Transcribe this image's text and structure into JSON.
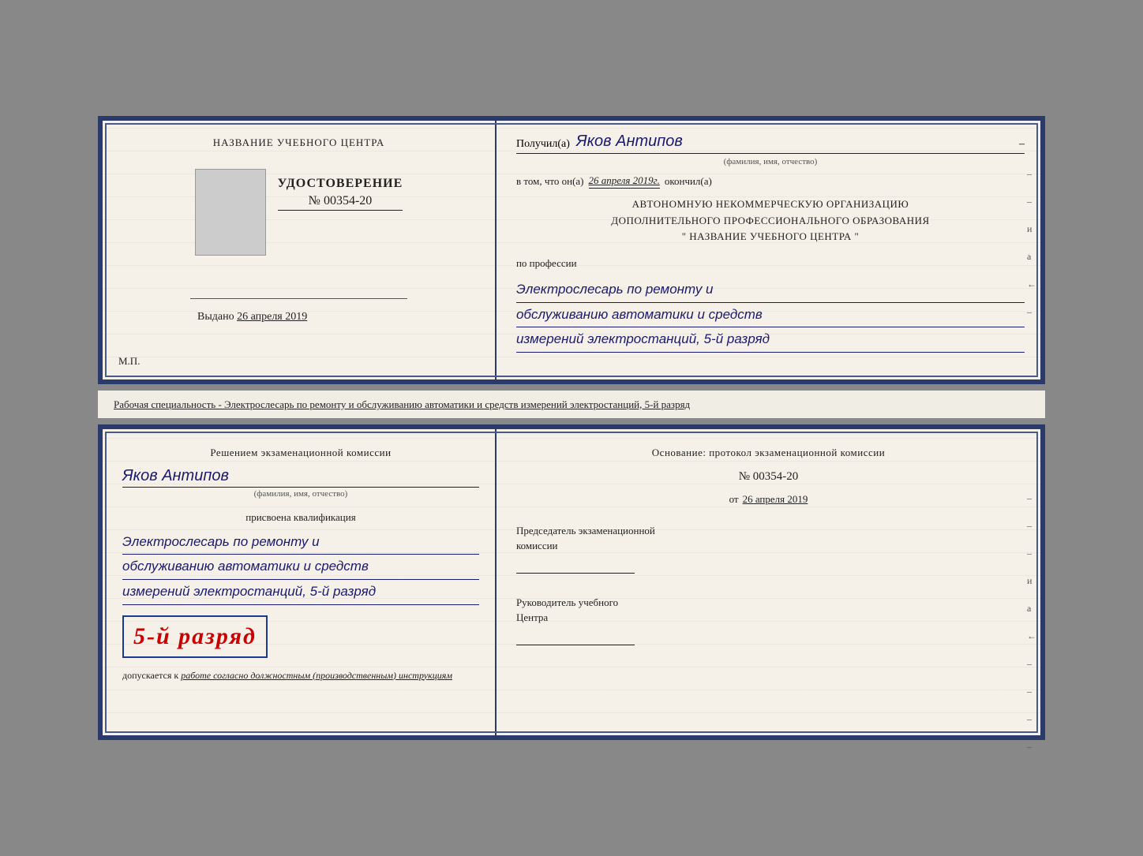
{
  "top_cert": {
    "left": {
      "org_name": "НАЗВАНИЕ УЧЕБНОГО ЦЕНТРА",
      "udostoverenie_label": "УДОСТОВЕРЕНИЕ",
      "number": "№ 00354-20",
      "vydano_label": "Выдано",
      "vydano_date": "26 апреля 2019",
      "mp_label": "М.П."
    },
    "right": {
      "poluchil_label": "Получил(а)",
      "recipient_name": "Яков Антипов",
      "fio_subtitle": "(фамилия, имя, отчество)",
      "vtom_label": "в том, что он(а)",
      "vtom_date": "26 апреля 2019г.",
      "okonchil_label": "окончил(а)",
      "org_line1": "АВТОНОМНУЮ НЕКОММЕРЧЕСКУЮ ОРГАНИЗАЦИЮ",
      "org_line2": "ДОПОЛНИТЕЛЬНОГО ПРОФЕССИОНАЛЬНОГО ОБРАЗОВАНИЯ",
      "org_quote_open": "\"",
      "org_center_name": "НАЗВАНИЕ УЧЕБНОГО ЦЕНТРА",
      "org_quote_close": "\"",
      "po_professii_label": "по профессии",
      "profession_line1": "Электрослесарь по ремонту и",
      "profession_line2": "обслуживанию автоматики и средств",
      "profession_line3": "измерений электростанций, 5-й разряд",
      "side_marks": [
        "–",
        "–",
        "и",
        "а",
        "←",
        "–"
      ]
    }
  },
  "middle": {
    "text": "Рабочая специальность - Электрослесарь по ремонту и обслуживанию автоматики и средств измерений электростанций, 5-й разряд"
  },
  "bottom_cert": {
    "left": {
      "resheniem_label": "Решением экзаменационной комиссии",
      "recipient_name": "Яков Антипов",
      "fio_subtitle": "(фамилия, имя, отчество)",
      "prisvoena_label": "присвоена квалификация",
      "profession_line1": "Электрослесарь по ремонту и",
      "profession_line2": "обслуживанию автоматики и средств",
      "profession_line3": "измерений электростанций, 5-й разряд",
      "razryad_big": "5-й разряд",
      "dopuskaetsya_label": "допускается к",
      "dopuskaetsya_text": "работе согласно должностным (производственным) инструкциям"
    },
    "right": {
      "osnovanie_label": "Основание: протокол экзаменационной комиссии",
      "number": "№ 00354-20",
      "ot_label": "от",
      "ot_date": "26 апреля 2019",
      "predsedatel_line1": "Председатель экзаменационной",
      "predsedatel_line2": "комиссии",
      "rukovoditel_line1": "Руководитель учебного",
      "rukovoditel_line2": "Центра",
      "side_marks": [
        "–",
        "–",
        "–",
        "и",
        "а",
        "←",
        "–",
        "–",
        "–",
        "–"
      ]
    }
  }
}
